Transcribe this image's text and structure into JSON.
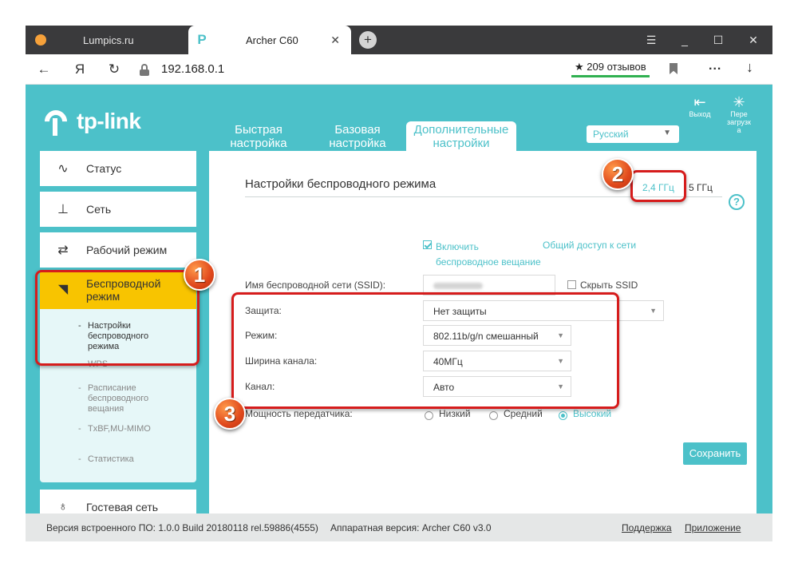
{
  "browser": {
    "tabs": [
      {
        "title": "Lumpics.ru"
      },
      {
        "title": "Archer C60"
      }
    ],
    "new_tab": "+",
    "controls": {
      "menu": "☰",
      "minimize": "_",
      "maximize": "☐",
      "close": "✕"
    },
    "nav": {
      "back": "←",
      "yandex": "Я",
      "reload": "↻"
    },
    "url": "192.168.0.1",
    "reviews": "★ 209 отзывов",
    "menu_dots": "...",
    "download": "↓"
  },
  "router": {
    "logo_text": "tp-link",
    "top_tabs": [
      {
        "label": "Быстрая\nнастройка"
      },
      {
        "label": "Базовая\nнастройка"
      },
      {
        "label": "Дополнительные\nнастройки"
      }
    ],
    "language": "Русский",
    "logout": "Выход",
    "reboot": "Пере\nзагрузк\nа"
  },
  "sidebar": {
    "items": [
      {
        "label": "Статус"
      },
      {
        "label": "Сеть"
      },
      {
        "label": "Рабочий режим"
      },
      {
        "label": "Беспроводной\nрежим"
      },
      {
        "label": "Гостевая сеть"
      }
    ],
    "subitems": [
      {
        "label": "Настройки\nбеспроводного\nрежима"
      },
      {
        "label": "WPS"
      },
      {
        "label": "Расписание\nбеспроводного\nвещания"
      },
      {
        "label": "TxBF,MU-MIMO"
      },
      {
        "label": "Статистика"
      }
    ]
  },
  "content": {
    "heading": "Настройки беспроводного режима",
    "band_24": "2,4 ГГц",
    "band_separator": "|",
    "band_5": "5 ГГц",
    "help": "?",
    "enable_label": "Включить\nбеспроводное вещание",
    "share_link": "Общий доступ к сети",
    "ssid_label": "Имя беспроводной сети (SSID):",
    "hide_ssid": "Скрыть SSID",
    "security_label": "Защита:",
    "security_value": "Нет защиты",
    "mode_label": "Режим:",
    "mode_value": "802.11b/g/n смешанный",
    "width_label": "Ширина канала:",
    "width_value": "40МГц",
    "channel_label": "Канал:",
    "channel_value": "Авто",
    "power_label": "Мощность передатчика:",
    "power_options": [
      {
        "label": "Низкий"
      },
      {
        "label": "Средний"
      },
      {
        "label": "Высокий"
      }
    ],
    "power_selected": "Высокий",
    "save": "Сохранить"
  },
  "footer": {
    "firmware": "Версия встроенного ПО: 1.0.0 Build 20180118 rel.59886(4555)",
    "hardware": "Аппаратная версия: Archer C60 v3.0",
    "support": "Поддержка",
    "app": "Приложение"
  },
  "annotations": {
    "one": "1",
    "two": "2",
    "three": "3"
  },
  "colors": {
    "accent": "#4cc1c9",
    "active_menu": "#f8c400",
    "highlight": "#d61c1c"
  }
}
